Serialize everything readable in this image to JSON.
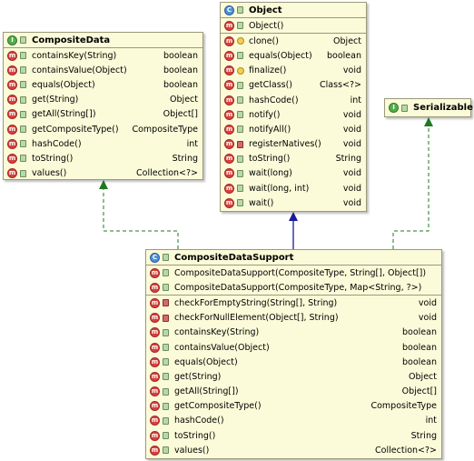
{
  "colors": {
    "box_fill": "#fbfbd9",
    "box_border": "#9a9a7c",
    "realization_arrow": "#1f7a1f",
    "generalization_arrow": "#1a1a9a"
  },
  "classes": {
    "composite_data": {
      "name": "CompositeData",
      "kind": "interface",
      "methods": [
        {
          "name": "containsKey(String)",
          "ret": "boolean"
        },
        {
          "name": "containsValue(Object)",
          "ret": "boolean"
        },
        {
          "name": "equals(Object)",
          "ret": "boolean"
        },
        {
          "name": "get(String)",
          "ret": "Object"
        },
        {
          "name": "getAll(String[])",
          "ret": "Object[]"
        },
        {
          "name": "getCompositeType()",
          "ret": "CompositeType"
        },
        {
          "name": "hashCode()",
          "ret": "int"
        },
        {
          "name": "toString()",
          "ret": "String"
        },
        {
          "name": "values()",
          "ret": "Collection<?>"
        }
      ]
    },
    "object": {
      "name": "Object",
      "kind": "class",
      "constructors": [
        {
          "name": "Object()",
          "ret": ""
        }
      ],
      "methods": [
        {
          "name": "clone()",
          "ret": "Object",
          "vis": "protected"
        },
        {
          "name": "equals(Object)",
          "ret": "boolean",
          "vis": "public"
        },
        {
          "name": "finalize()",
          "ret": "void",
          "vis": "protected"
        },
        {
          "name": "getClass()",
          "ret": "Class<?>",
          "vis": "public"
        },
        {
          "name": "hashCode()",
          "ret": "int",
          "vis": "public"
        },
        {
          "name": "notify()",
          "ret": "void",
          "vis": "public"
        },
        {
          "name": "notifyAll()",
          "ret": "void",
          "vis": "public"
        },
        {
          "name": "registerNatives()",
          "ret": "void",
          "vis": "private"
        },
        {
          "name": "toString()",
          "ret": "String",
          "vis": "public"
        },
        {
          "name": "wait(long)",
          "ret": "void",
          "vis": "public"
        },
        {
          "name": "wait(long, int)",
          "ret": "void",
          "vis": "public"
        },
        {
          "name": "wait()",
          "ret": "void",
          "vis": "public"
        }
      ]
    },
    "serializable": {
      "name": "Serializable",
      "kind": "interface"
    },
    "composite_data_support": {
      "name": "CompositeDataSupport",
      "kind": "class",
      "constructors": [
        {
          "name": "CompositeDataSupport(CompositeType, String[], Object[])",
          "ret": ""
        },
        {
          "name": "CompositeDataSupport(CompositeType, Map<String, ?>)",
          "ret": ""
        }
      ],
      "methods": [
        {
          "name": "checkForEmptyString(String[], String)",
          "ret": "void",
          "vis": "private"
        },
        {
          "name": "checkForNullElement(Object[], String)",
          "ret": "void",
          "vis": "private"
        },
        {
          "name": "containsKey(String)",
          "ret": "boolean",
          "vis": "public"
        },
        {
          "name": "containsValue(Object)",
          "ret": "boolean",
          "vis": "public"
        },
        {
          "name": "equals(Object)",
          "ret": "boolean",
          "vis": "public"
        },
        {
          "name": "get(String)",
          "ret": "Object",
          "vis": "public"
        },
        {
          "name": "getAll(String[])",
          "ret": "Object[]",
          "vis": "public"
        },
        {
          "name": "getCompositeType()",
          "ret": "CompositeType",
          "vis": "public"
        },
        {
          "name": "hashCode()",
          "ret": "int",
          "vis": "public"
        },
        {
          "name": "toString()",
          "ret": "String",
          "vis": "public"
        },
        {
          "name": "values()",
          "ret": "Collection<?>",
          "vis": "public"
        }
      ]
    }
  }
}
